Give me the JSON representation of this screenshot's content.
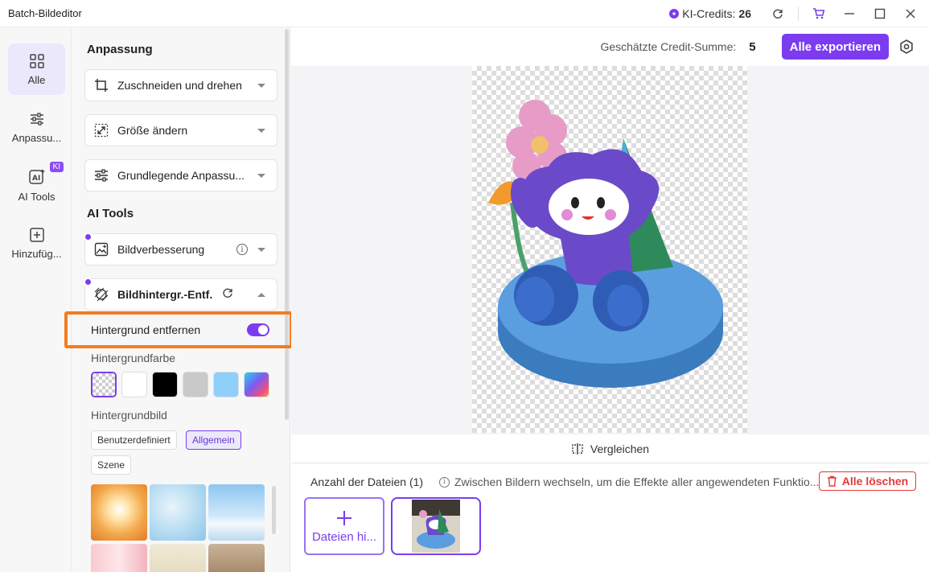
{
  "window": {
    "title": "Batch-Bildeditor",
    "credits_label": "KI-Credits:",
    "credits_value": "26"
  },
  "rail": {
    "items": [
      {
        "label": "Alle",
        "icon": "grid-icon"
      },
      {
        "label": "Anpassu...",
        "icon": "sliders-icon"
      },
      {
        "label": "AI Tools",
        "icon": "ai-icon",
        "badge": "KI"
      },
      {
        "label": "Hinzufüg...",
        "icon": "plus-square-icon"
      }
    ]
  },
  "panel": {
    "section_adjust": "Anpassung",
    "crop": "Zuschneiden und drehen",
    "resize": "Größe ändern",
    "basic": "Grundlegende Anpassu...",
    "section_ai": "AI Tools",
    "enhance": "Bildverbesserung",
    "bg_remove": "Bildhintergr.-Entf.",
    "toggle_label": "Hintergrund entfernen",
    "toggle_on": true,
    "bg_color_label": "Hintergrundfarbe",
    "bg_colors": [
      "transparent",
      "#ffffff",
      "#000000",
      "#c9c9c9",
      "#8fd0fb",
      "gradient"
    ],
    "bg_image_label": "Hintergrundbild",
    "chips": [
      "Benutzerdefiniert",
      "Allgemein",
      "Szene"
    ],
    "selected_chip": "Allgemein"
  },
  "topbar": {
    "credit_sum_label": "Geschätzte Credit-Summe:",
    "credit_sum_value": "5",
    "export_label": "Alle exportieren"
  },
  "compare_label": "Vergleichen",
  "files": {
    "count_label": "Anzahl der Dateien (1)",
    "hint": "Zwischen Bildern wechseln, um die Effekte aller angewendeten Funktio...",
    "delete_label": "Alle löschen",
    "add_label": "Dateien hi..."
  }
}
